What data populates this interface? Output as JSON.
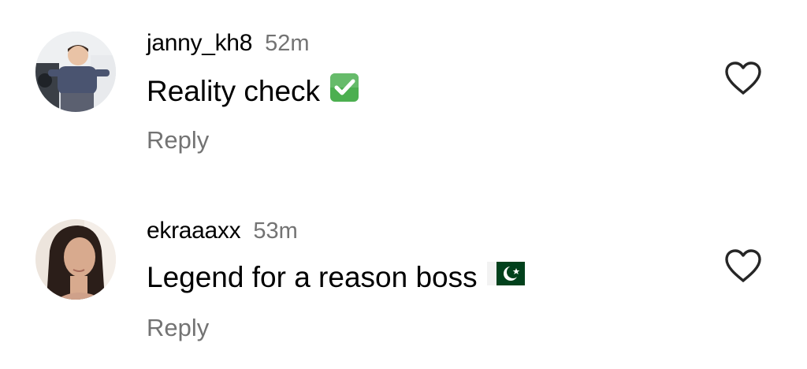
{
  "comments": [
    {
      "username": "janny_kh8",
      "time": "52m",
      "text": "Reality check",
      "emoji": "check-mark-button",
      "reply_label": "Reply",
      "liked": false
    },
    {
      "username": "ekraaaxx",
      "time": "53m",
      "text": "Legend for a reason boss",
      "emoji": "pakistan-flag",
      "reply_label": "Reply",
      "liked": false
    }
  ],
  "colors": {
    "text_primary": "#000000",
    "text_secondary": "#737373",
    "heart_outline": "#262626",
    "check_emoji_bg": "#4CAF50",
    "flag_green": "#01411C"
  }
}
